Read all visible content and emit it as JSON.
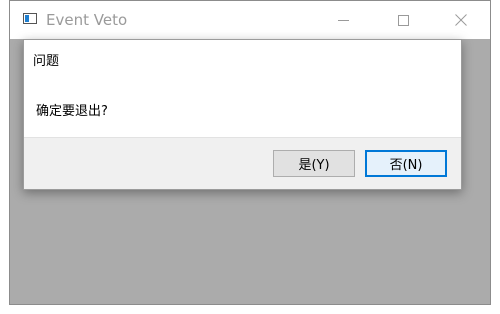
{
  "window": {
    "title": "Event Veto",
    "icon": "app-window-icon",
    "controls": {
      "minimize_icon": "minimize-icon",
      "maximize_icon": "maximize-icon",
      "close_icon": "close-icon",
      "close_glyph": "✕"
    }
  },
  "dialog": {
    "title": "问题",
    "message": "确定要退出?",
    "yes_label": "是(Y)",
    "no_label": "否(N)"
  },
  "colors": {
    "accent": "#0078d7",
    "client_background": "#ababab",
    "title_text": "#9a9a9a"
  }
}
